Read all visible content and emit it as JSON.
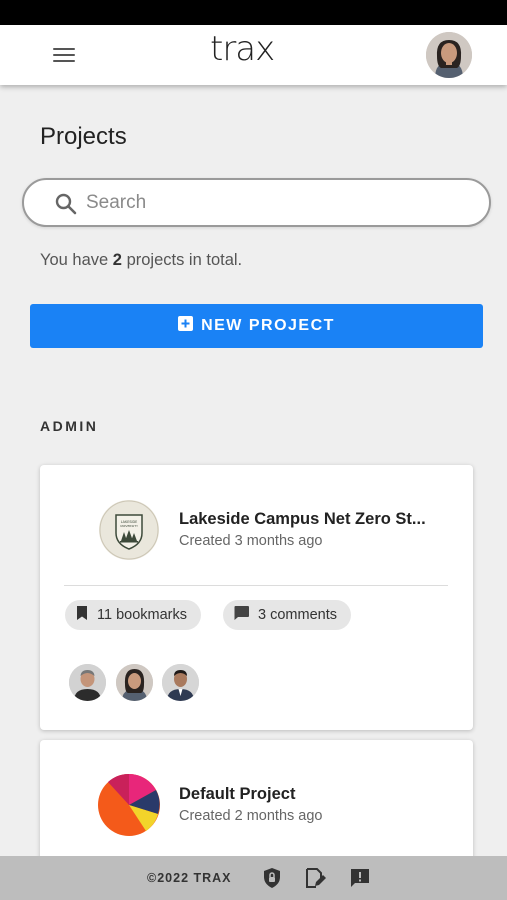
{
  "app": {
    "logo_text": "trax"
  },
  "header": {
    "menu_icon": "menu-icon",
    "avatar_icon": "user-avatar"
  },
  "page": {
    "title": "Projects"
  },
  "search": {
    "placeholder": "Search",
    "icon": "search-icon"
  },
  "summary": {
    "prefix": "You have ",
    "count": "2",
    "suffix": " projects in total."
  },
  "new_project_button": {
    "label": "NEW PROJECT",
    "icon": "plus-box-icon"
  },
  "section": {
    "label": "ADMIN"
  },
  "projects": [
    {
      "name": "Lakeside Campus Net Zero St...",
      "created": "Created 3 months ago",
      "logo_text": [
        "LAKESIDE",
        "UNIVERSITY"
      ],
      "bookmarks": "11 bookmarks",
      "comments": "3 comments",
      "members_count": 3
    },
    {
      "name": "Default Project",
      "created": "Created 2 months ago"
    }
  ],
  "footer": {
    "copyright": "©2022 TRAX",
    "icons": [
      "shield-lock-icon",
      "edit-document-icon",
      "feedback-icon"
    ]
  },
  "colors": {
    "primary": "#1a82f5",
    "background": "#efefef",
    "footer": "#bdbdbd"
  }
}
